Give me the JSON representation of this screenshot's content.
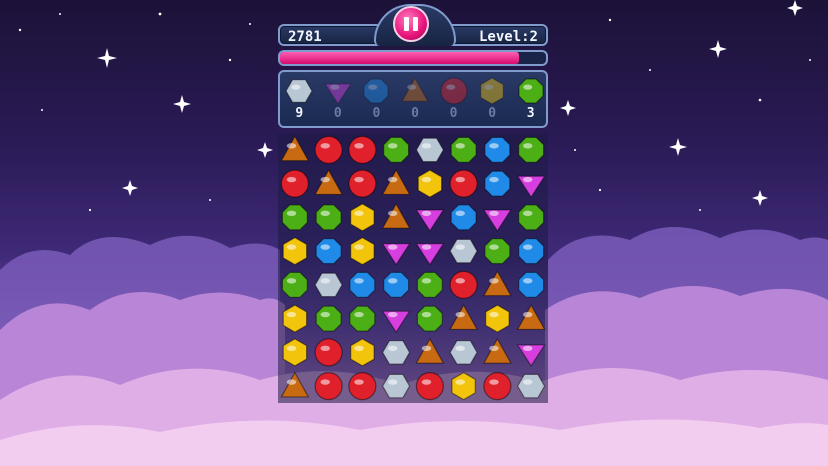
{
  "hud": {
    "score": "2781",
    "level": "Level:2",
    "progress_fraction": 0.9
  },
  "goals": [
    {
      "gem": "white",
      "count": "9"
    },
    {
      "gem": "purple",
      "count": "0"
    },
    {
      "gem": "blue",
      "count": "0"
    },
    {
      "gem": "orange",
      "count": "0"
    },
    {
      "gem": "red",
      "count": "0"
    },
    {
      "gem": "yellow",
      "count": "0"
    },
    {
      "gem": "green",
      "count": "3"
    }
  ],
  "board": [
    [
      "orange",
      "red",
      "red",
      "green",
      "white",
      "green",
      "blue",
      "green"
    ],
    [
      "red",
      "orange",
      "red",
      "orange",
      "yellow",
      "red",
      "blue",
      "purple"
    ],
    [
      "green",
      "green",
      "yellow",
      "orange",
      "purple",
      "blue",
      "purple",
      "green"
    ],
    [
      "yellow",
      "blue",
      "yellow",
      "purple",
      "purple",
      "white",
      "green",
      "blue"
    ],
    [
      "green",
      "white",
      "blue",
      "blue",
      "green",
      "red",
      "orange",
      "blue"
    ],
    [
      "yellow",
      "green",
      "green",
      "purple",
      "green",
      "orange",
      "yellow",
      "orange"
    ],
    [
      "yellow",
      "red",
      "yellow",
      "white",
      "orange",
      "white",
      "orange",
      "purple"
    ],
    [
      "orange",
      "red",
      "red",
      "white",
      "red",
      "yellow",
      "red",
      "white"
    ]
  ],
  "colors": {
    "red": "#e0212b",
    "orange": "#c86a12",
    "yellow": "#f2c40c",
    "green": "#4caf16",
    "blue": "#1f8ae8",
    "purple": "#d63ee0",
    "white": "#b9c6d4",
    "accent_pink": "#e8127a"
  }
}
